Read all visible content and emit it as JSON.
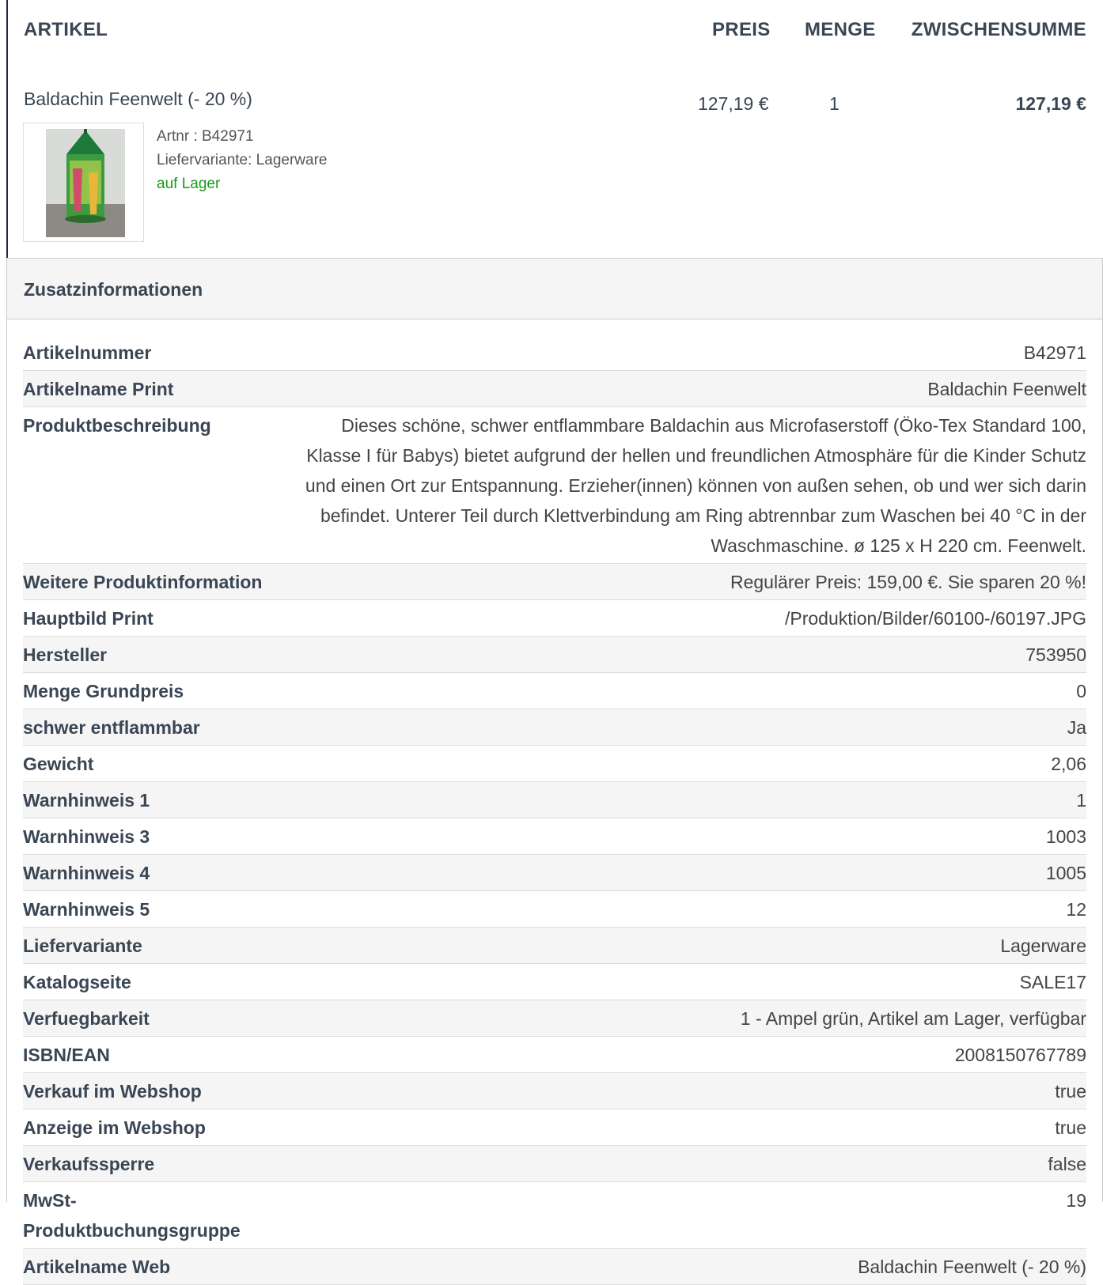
{
  "cart_header": {
    "artikel": "ARTIKEL",
    "preis": "PREIS",
    "menge": "MENGE",
    "zwischensumme": "ZWISCHENSUMME"
  },
  "item": {
    "name": "Baldachin Feenwelt (- 20 %)",
    "price": "127,19 €",
    "quantity": "1",
    "subtotal": "127,19 €",
    "artnr": "Artnr : B42971",
    "liefervariante": "Liefervariante: Lagerware",
    "stock": "auf Lager",
    "stock_color": "#1a9a1a"
  },
  "zusatz": {
    "title": "Zusatzinformationen",
    "rows": [
      {
        "key": "Artikelnummer",
        "value": "B42971"
      },
      {
        "key": "Artikelname Print",
        "value": "Baldachin Feenwelt"
      },
      {
        "key": "Produktbeschreibung",
        "value": "Dieses schöne, schwer entflammbare Baldachin aus Microfaserstoff (Öko-Tex Standard 100, Klasse I für Babys) bietet aufgrund der hellen und freundlichen Atmosphäre für die Kinder Schutz und einen Ort zur Entspannung. Erzieher(innen) können von außen sehen, ob und wer sich darin befindet. Unterer Teil durch Klettverbindung am Ring abtrennbar zum Waschen bei 40 °C in der Waschmaschine. ø 125 x H 220 cm. Feenwelt."
      },
      {
        "key": "Weitere Produktinformation",
        "value": "Regulärer Preis: 159,00 €. Sie sparen 20 %!"
      },
      {
        "key": "Hauptbild Print",
        "value": "/Produktion/Bilder/60100-/60197.JPG"
      },
      {
        "key": "Hersteller",
        "value": "753950"
      },
      {
        "key": "Menge Grundpreis",
        "value": "0"
      },
      {
        "key": "schwer entflammbar",
        "value": "Ja"
      },
      {
        "key": "Gewicht",
        "value": "2,06"
      },
      {
        "key": "Warnhinweis 1",
        "value": "1"
      },
      {
        "key": "Warnhinweis 3",
        "value": "1003"
      },
      {
        "key": "Warnhinweis 4",
        "value": "1005"
      },
      {
        "key": "Warnhinweis 5",
        "value": "12"
      },
      {
        "key": "Liefervariante",
        "value": "Lagerware"
      },
      {
        "key": "Katalogseite",
        "value": "SALE17"
      },
      {
        "key": "Verfuegbarkeit",
        "value": "1 - Ampel grün, Artikel am Lager, verfügbar"
      },
      {
        "key": "ISBN/EAN",
        "value": "2008150767789"
      },
      {
        "key": "Verkauf im Webshop",
        "value": "true"
      },
      {
        "key": "Anzeige im Webshop",
        "value": "true"
      },
      {
        "key": "Verkaufssperre",
        "value": "false"
      },
      {
        "key": "MwSt-Produktbuchungsgruppe",
        "value": "19"
      },
      {
        "key": "Artikelname Web",
        "value": "Baldachin Feenwelt (- 20 %)"
      }
    ]
  }
}
